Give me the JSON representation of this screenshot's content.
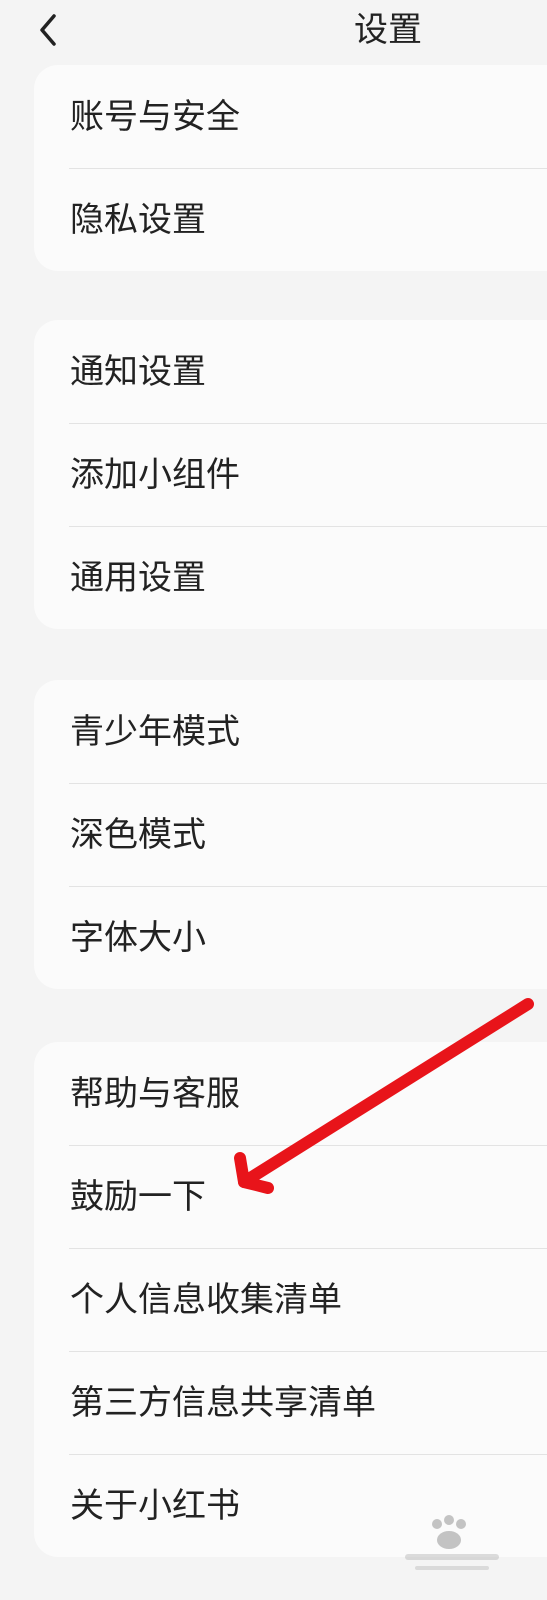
{
  "header": {
    "title": "设置",
    "back_icon": "chevron-left-icon"
  },
  "groups": [
    {
      "items": [
        {
          "label": "账号与安全"
        },
        {
          "label": "隐私设置"
        }
      ]
    },
    {
      "items": [
        {
          "label": "通知设置"
        },
        {
          "label": "添加小组件"
        },
        {
          "label": "通用设置"
        }
      ]
    },
    {
      "items": [
        {
          "label": "青少年模式"
        },
        {
          "label": "深色模式"
        },
        {
          "label": "字体大小"
        }
      ]
    },
    {
      "items": [
        {
          "label": "帮助与客服"
        },
        {
          "label": "鼓励一下"
        },
        {
          "label": "个人信息收集清单"
        },
        {
          "label": "第三方信息共享清单"
        },
        {
          "label": "关于小红书"
        }
      ]
    }
  ],
  "annotation": {
    "arrow_color": "#e8141a"
  },
  "watermark": {
    "icon": "baidu-jingyan-watermark"
  },
  "colors": {
    "background": "#f4f4f4",
    "card": "#fbfbfb",
    "divider": "#e3e3e3",
    "text": "#222222"
  }
}
